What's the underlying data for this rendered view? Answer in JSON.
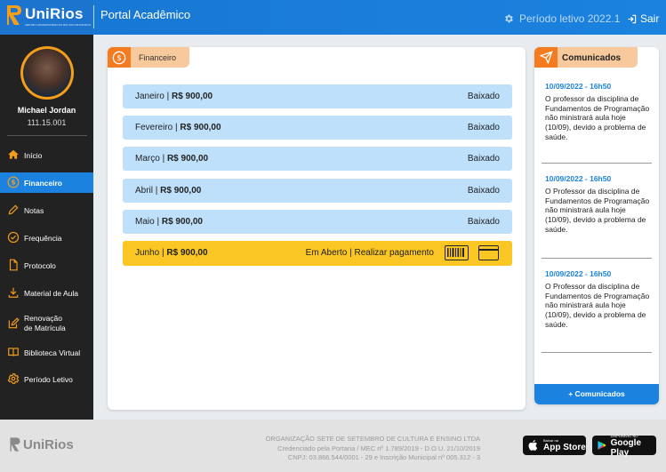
{
  "header": {
    "brand_name": "UniRios",
    "brand_tagline": "CENTRO UNIVERSITÁRIO DO RIO SÃO FRANCISCO",
    "title": "Portal Acadêmico",
    "period": "Período letivo 2022.1",
    "exit": "Sair"
  },
  "user": {
    "name": "Michael Jordan",
    "id": "111.15.001"
  },
  "sidebar": {
    "items": [
      {
        "label": "Início",
        "icon": "home-icon",
        "active": false
      },
      {
        "label": "Financeiro",
        "icon": "dollar-icon",
        "active": true
      },
      {
        "label": "Notas",
        "icon": "pencil-icon",
        "active": false
      },
      {
        "label": "Frequência",
        "icon": "check-circle-icon",
        "active": false
      },
      {
        "label": "Protocolo",
        "icon": "document-icon",
        "active": false
      },
      {
        "label": "Material de Aula",
        "icon": "download-icon",
        "active": false
      },
      {
        "label": "Renovação",
        "label2": "de Matrícula",
        "icon": "edit-icon",
        "active": false
      },
      {
        "label": "Biblioteca Virtual",
        "icon": "book-icon",
        "active": false
      },
      {
        "label": "Período Letivo",
        "icon": "gear-icon",
        "active": false
      }
    ]
  },
  "financeiro": {
    "tab_label": "Financeiro",
    "rows": [
      {
        "month": "Janeiro",
        "amount": "R$ 900,00",
        "status": "Baixado"
      },
      {
        "month": "Fevereiro",
        "amount": "R$ 900,00",
        "status": "Baixado"
      },
      {
        "month": "Março",
        "amount": "R$ 900,00",
        "status": "Baixado"
      },
      {
        "month": "Abril",
        "amount": "R$ 900,00",
        "status": "Baixado"
      },
      {
        "month": "Maio",
        "amount": "R$ 900,00",
        "status": "Baixado"
      },
      {
        "month": "Junho",
        "amount": "R$ 900,00",
        "status": "Em Aberto | Realizar pagamento"
      }
    ],
    "sep": " | "
  },
  "comunicados": {
    "tab_label": "Comunicados",
    "items": [
      {
        "date": "10/09/2022 - 16h50",
        "text": "O professor da disciplina de Fundamentos de Programação não ministrará aula hoje (10/09), devido a problema de saúde."
      },
      {
        "date": "10/09/2022 - 16h50",
        "text": "O Professor da disciplina de Fundamentos de Programação não ministrará aula hoje (10/09), devido a problema de saúde."
      },
      {
        "date": "10/09/2022 - 16h50",
        "text": "O Professor da disciplina de Fundamentos de Programação não ministrará aula hoje (10/09), devido a problema de saúde."
      }
    ],
    "more_label": "+ Comunicados"
  },
  "footer": {
    "logo": "UniRios",
    "line1": "ORGANIZAÇÃO SETE DE SETEMBRO DE CULTURA E ENSINO LTDA",
    "line2": "Credenciado pela Portaria / MEC nº 1.789/2019 - D.O.U. 21/10/2019",
    "line3": "CNPJ: 03.866.544/0001 - 29 e Inscrição Municipal nº 005.312 - 3",
    "appstore_small": "Baixar na",
    "appstore_big": "App Store",
    "play_small": "DISPONÍVEL NO",
    "play_big": "Google Play"
  },
  "colors": {
    "primary": "#1b82df",
    "accent_orange": "#f47b20",
    "tab_peach": "#f8c99c",
    "row_blue": "#bee0fb",
    "row_open": "#f9c623",
    "sidebar_bg": "#222222"
  }
}
